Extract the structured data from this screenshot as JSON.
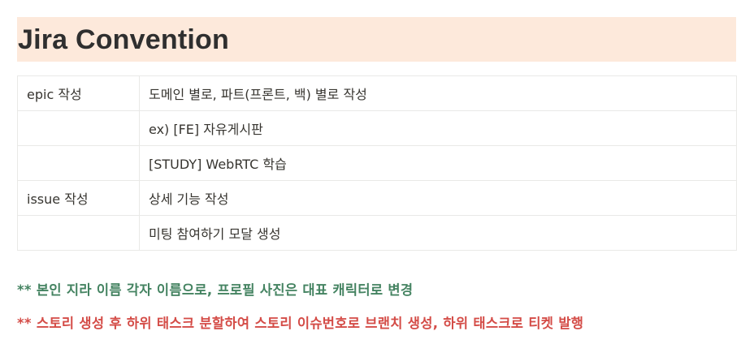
{
  "heading": {
    "title": "Jira Convention",
    "background_color": "#fde9db"
  },
  "table": {
    "rows": [
      [
        "epic 작성",
        "도메인 별로, 파트(프론트, 백) 별로 작성"
      ],
      [
        "",
        "ex) [FE] 자유게시판"
      ],
      [
        "",
        "[STUDY] WebRTC 학습"
      ],
      [
        "issue 작성",
        "상세 기능 작성"
      ],
      [
        "",
        "미팅 참여하기 모달 생성"
      ]
    ]
  },
  "notes": [
    {
      "text": "** 본인 지라 이름 각자 이름으로, 프로필 사진은 대표 캐릭터로 변경",
      "color": "#448361"
    },
    {
      "text": "** 스토리 생성 후 하위 태스크 분할하여 스토리 이슈번호로 브랜치 생성, 하위 태스크로 티켓 발행",
      "color": "#d44c47"
    }
  ]
}
